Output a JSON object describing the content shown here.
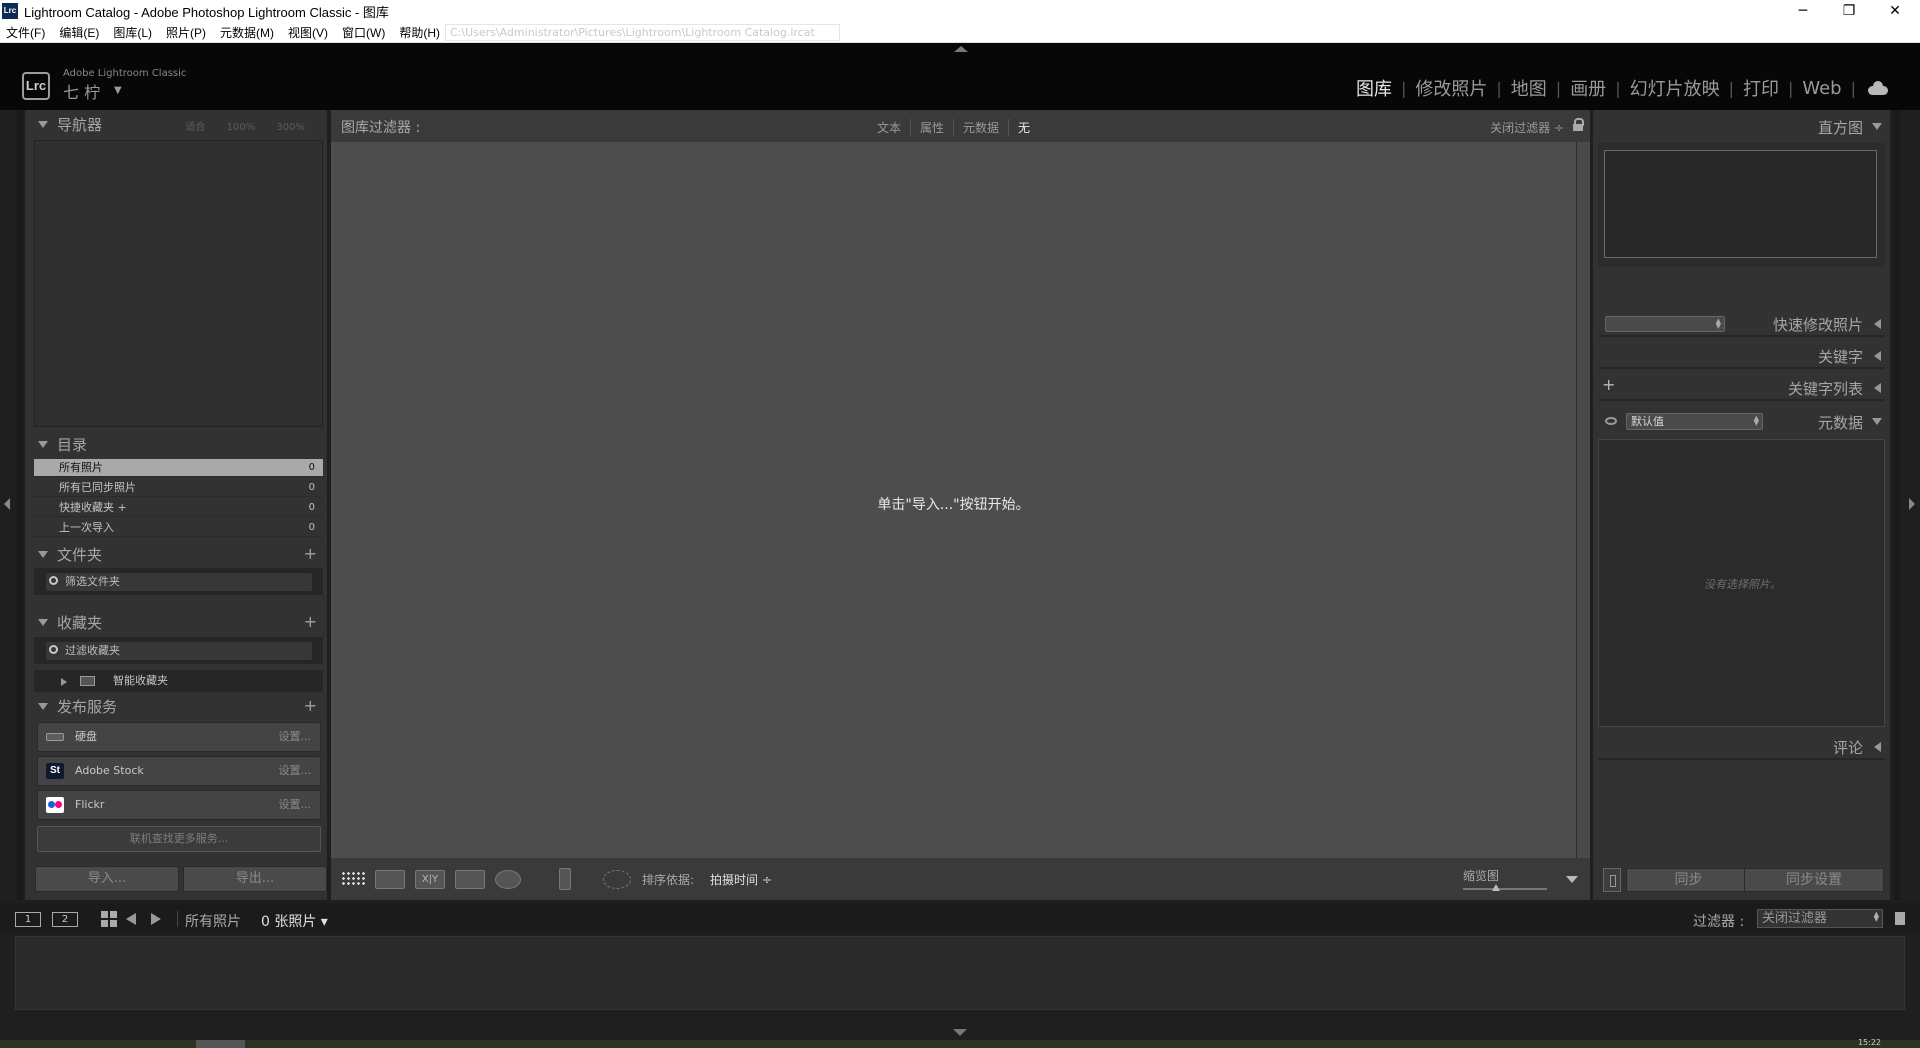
{
  "window": {
    "title": "Lightroom Catalog - Adobe Photoshop Lightroom Classic - 图库",
    "app_icon": "Lrc",
    "controls": {
      "minimize": "─",
      "maximize": "❐",
      "close": "✕"
    }
  },
  "menu": {
    "items": [
      "文件(F)",
      "编辑(E)",
      "图库(L)",
      "照片(P)",
      "元数据(M)",
      "视图(V)",
      "窗口(W)",
      "帮助(H)"
    ],
    "path_hint": "C:\\Users\\Administrator\\Pictures\\Lightroom\\Lightroom Catalog.lrcat"
  },
  "header": {
    "badge": "Lrc",
    "brand_sub": "Adobe Lightroom Classic",
    "user": "七 柠",
    "user_caret": "▼",
    "modules": [
      "图库",
      "修改照片",
      "地图",
      "画册",
      "幻灯片放映",
      "打印",
      "Web"
    ],
    "active_module": "图库",
    "cloud_icon": "cloud-icon"
  },
  "left": {
    "navigator": {
      "title": "导航器",
      "options": [
        "适合",
        "100%",
        "300%"
      ]
    },
    "catalog": {
      "title": "目录",
      "rows": [
        {
          "label": "所有照片",
          "count": "0"
        },
        {
          "label": "所有已同步照片",
          "count": "0"
        },
        {
          "label": "快捷收藏夹 +",
          "count": "0"
        },
        {
          "label": "上一次导入",
          "count": "0"
        }
      ]
    },
    "folders": {
      "title": "文件夹",
      "plus": "+",
      "filter_placeholder": "筛选文件夹"
    },
    "collections": {
      "title": "收藏夹",
      "plus": "+",
      "filter_placeholder": "过滤收藏夹",
      "smart": "智能收藏夹"
    },
    "publish": {
      "title": "发布服务",
      "plus": "+",
      "services": [
        {
          "name": "硬盘",
          "setup": "设置...",
          "icon": "hard-drive-icon"
        },
        {
          "name": "Adobe Stock",
          "setup": "设置...",
          "icon": "adobe-stock-icon",
          "icon_text": "St"
        },
        {
          "name": "Flickr",
          "setup": "设置...",
          "icon": "flickr-icon"
        }
      ],
      "more": "联机查找更多服务..."
    },
    "import_label": "导入...",
    "export_label": "导出..."
  },
  "center": {
    "filter_title": "图库过滤器 :",
    "filter_tabs": [
      "文本",
      "属性",
      "元数据",
      "无"
    ],
    "filter_off": "关闭过滤器 ÷",
    "empty_message": "单击\"导入...\"按钮开始。",
    "toolbar": {
      "loupe": "",
      "compare": "X|Y",
      "survey": "",
      "people": "",
      "sort_label": "排序依据:",
      "sort_value": "拍摄时间 ÷",
      "thumb_label": "缩览图"
    }
  },
  "right": {
    "histogram": "直方图",
    "quick_develop": "快速修改照片",
    "keywording": "关键字",
    "keyword_list": "关键字列表",
    "keyword_plus": "+",
    "metadata": "元数据",
    "metadata_preset": "默认值",
    "no_photo": "没有选择照片。",
    "comments": "评论",
    "sync_label": "同步",
    "sync_settings_label": "同步设置"
  },
  "filmstrip": {
    "monitor1": "1",
    "monitor2": "2",
    "source": "所有照片",
    "count": "0 张照片 ▾",
    "filter_label": "过滤器 :",
    "filter_value": "关闭过滤器"
  },
  "taskbar": {
    "clock": "15:22"
  }
}
